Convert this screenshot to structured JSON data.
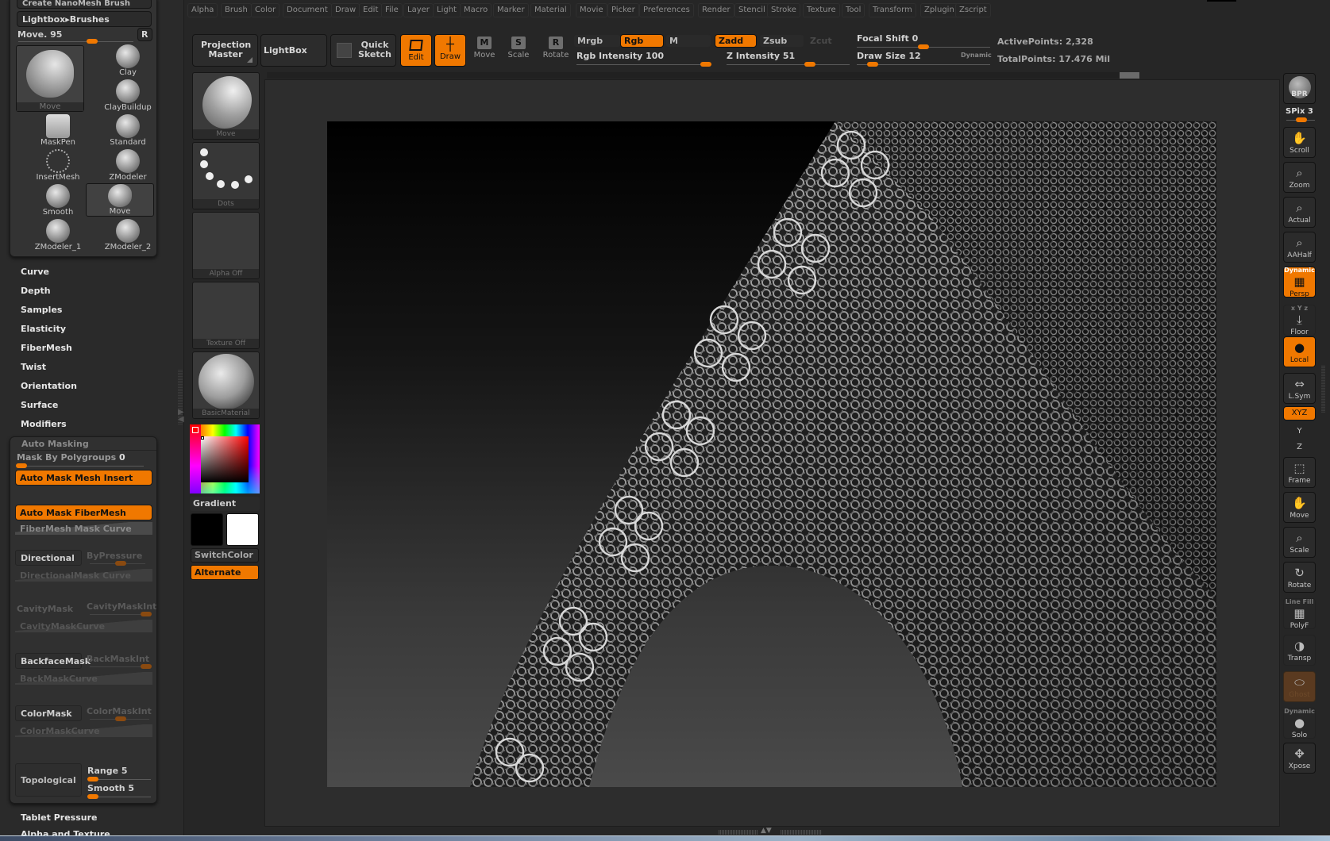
{
  "top_menu": [
    "Alpha",
    "Brush",
    "Color",
    "Document",
    "Draw",
    "Edit",
    "File",
    "Layer",
    "Light",
    "Macro",
    "Marker",
    "Material",
    "Movie",
    "Picker",
    "Preferences",
    "Render",
    "Stencil",
    "Stroke",
    "Texture",
    "Tool",
    "Transform",
    "Zplugin",
    "Zscript"
  ],
  "left_panel": {
    "header_cut": "Create NanoMesh Brush",
    "lightbox_brushes": "Lightbox▸Brushes",
    "current_brush": "Move. 95",
    "current_brush_value": 0.5,
    "reset_button": "R",
    "brushes": [
      {
        "name": "Move",
        "selected": true,
        "large": true
      },
      {
        "name": "Clay"
      },
      {
        "name": "ClayBuildup"
      },
      {
        "name": "MaskPen"
      },
      {
        "name": "Standard"
      },
      {
        "name": "InsertMesh"
      },
      {
        "name": "ZModeler"
      },
      {
        "name": "Smooth"
      },
      {
        "name": "Move",
        "selected": true
      },
      {
        "name": "ZModeler_1"
      },
      {
        "name": "ZModeler_2"
      }
    ],
    "subpalettes": [
      "Curve",
      "Depth",
      "Samples",
      "Elasticity",
      "FiberMesh",
      "Twist",
      "Orientation",
      "Surface",
      "Modifiers"
    ],
    "auto_masking": {
      "title": "Auto Masking",
      "mask_by_polygroups_label": "Mask By Polygroups",
      "mask_by_polygroups_value": "0",
      "auto_mask_mesh_insert": "Auto Mask Mesh Insert",
      "auto_mask_fibermesh": "Auto Mask FiberMesh",
      "fibermesh_mask_curve": "FiberMesh Mask Curve",
      "directional": "Directional",
      "by_pressure": "ByPressure",
      "directional_mask_curve": "DirectionalMask Curve",
      "cavity_mask": "CavityMask",
      "cavity_mask_int": "CavityMaskInt",
      "cavity_mask_curve": "CavityMaskCurve",
      "backface_mask": "BackfaceMask",
      "back_mask_int": "BackMaskInt",
      "back_mask_curve": "BackMaskCurve",
      "color_mask": "ColorMask",
      "color_mask_int": "ColorMaskInt",
      "color_mask_curve": "ColorMaskCurve",
      "topological": "Topological",
      "range_label": "Range 5",
      "smooth_label": "Smooth 5"
    },
    "tablet_pressure": "Tablet Pressure",
    "alpha_and_texture_cut": "Alpha and Texture"
  },
  "tool_column": {
    "brush_tile": "Move",
    "stroke_tile": "Dots",
    "alpha_tile": "Alpha  Off",
    "texture_tile": "Texture  Off",
    "material_tile": "BasicMaterial",
    "gradient_label": "Gradient",
    "switch_color": "SwitchColor",
    "alternate": "Alternate",
    "main_color": "#000000",
    "secondary_color": "#ffffff",
    "picker_hue": "#ff0000"
  },
  "toolbar": {
    "projection_master": "Projection Master",
    "lightbox": "LightBox",
    "quick_sketch": "Quick Sketch",
    "edit": "Edit",
    "draw": "Draw",
    "move": "Move",
    "scale": "Scale",
    "rotate": "Rotate",
    "move_key": "M",
    "scale_key": "S",
    "rotate_key": "R",
    "mrgb": "Mrgb",
    "rgb": "Rgb",
    "m": "M",
    "zadd": "Zadd",
    "zsub": "Zsub",
    "zcut": "Zcut",
    "rgb_intensity": "Rgb  Intensity 100",
    "rgb_intensity_value": 100,
    "z_intensity": "Z  Intensity 51",
    "z_intensity_value": 51,
    "focal_shift": "Focal  Shift 0",
    "focal_shift_value": 0,
    "draw_size": "Draw  Size 12",
    "draw_size_value": 12,
    "dynamic": "Dynamic",
    "active_points": "ActivePoints: 2,328",
    "total_points": "TotalPoints: 17.476  Mil"
  },
  "right_shelf": {
    "bpr": "BPR",
    "spix": "SPix 3",
    "buttons": [
      {
        "label": "Scroll",
        "icon": "hand-icon"
      },
      {
        "label": "Zoom",
        "icon": "zoom-icon"
      },
      {
        "label": "Actual",
        "icon": "actual-size-icon"
      },
      {
        "label": "AAHalf",
        "icon": "aahalf-icon"
      },
      {
        "label": "Persp",
        "icon": "perspective-icon",
        "top": "Dynamic",
        "on": true
      },
      {
        "label": "Floor",
        "icon": "floor-icon",
        "top": "x Y z"
      },
      {
        "label": "Local",
        "icon": "local-icon",
        "on": true
      },
      {
        "label": "L.Sym",
        "icon": "local-symmetry-icon"
      },
      {
        "label": "XYZ",
        "icon": "rotate-xyz-icon",
        "on": true
      },
      {
        "label": "Y",
        "icon": "rotate-y-icon"
      },
      {
        "label": "Z",
        "icon": "rotate-z-icon"
      },
      {
        "label": "Frame",
        "icon": "frame-icon"
      },
      {
        "label": "Move",
        "icon": "move-icon"
      },
      {
        "label": "Scale",
        "icon": "scale-icon"
      },
      {
        "label": "Rotate",
        "icon": "rotate-icon"
      },
      {
        "label": "PolyF",
        "icon": "polyframe-icon",
        "top": "Line Fill"
      },
      {
        "label": "Transp",
        "icon": "transparency-icon"
      },
      {
        "label": "Ghost",
        "icon": "ghost-icon"
      },
      {
        "label": "Solo",
        "icon": "solo-icon",
        "top": "Dynamic"
      },
      {
        "label": "Xpose",
        "icon": "xpose-icon"
      }
    ]
  },
  "accent_color": "#f07800"
}
